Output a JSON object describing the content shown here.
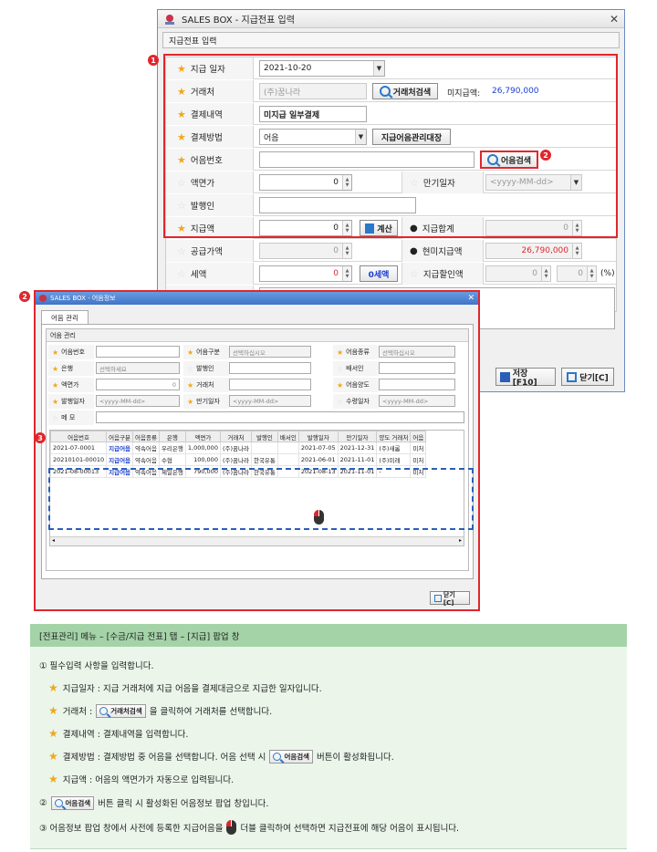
{
  "win1": {
    "title": "SALES BOX - 지급전표 입력",
    "tab": "지급전표 입력",
    "badge1": "1",
    "badge2": "2",
    "rows": {
      "date_label": "지급 일자",
      "date_value": "2021-10-20",
      "vendor_label": "거래처",
      "vendor_value": "(주)꿈나라",
      "vendor_btn": "거래처검색",
      "unpaid_label": "미지급액:",
      "unpaid_value": "26,790,000",
      "memo_label": "결제내역",
      "memo_value": "미지급 일부결제",
      "method_label": "결제방법",
      "method_value": "어음",
      "ledger_btn": "지급어음관리대장",
      "note_no_label": "어음번호",
      "note_search_btn": "어음검색",
      "face_label": "액면가",
      "face_value": "0",
      "due_label": "만기일자",
      "due_placeholder": "<yyyy-MM-dd>",
      "issuer_label": "발행인",
      "pay_label": "지급액",
      "pay_value": "0",
      "calc_btn": "계산",
      "total_label": "지급합계",
      "total_value": "0",
      "supply_label": "공급가액",
      "supply_value": "0",
      "cash_label": "현미지급액",
      "cash_value": "26,790,000",
      "tax_label": "세액",
      "tax_value": "0",
      "tax_btn": "0세액",
      "disc_label": "지급할인액",
      "disc_value": "0",
      "disc_value2": "0",
      "pct": "(%)"
    },
    "save_btn": "저장[F10]",
    "close_btn": "닫기[C]"
  },
  "win2": {
    "title": "SALES BOX - 어음정보",
    "badge": "2",
    "tab": "어음 관리",
    "panel_title": "어음 관리",
    "badge3": "3",
    "filters": {
      "note_no": "어음번호",
      "note_type": "어음구분",
      "note_type_ph": "선택하십시오",
      "note_kind": "어음종류",
      "note_kind_ph": "선택하십시오",
      "bank": "은행",
      "bank_ph": "선택하세요",
      "issuer": "발행인",
      "endorser": "배서인",
      "face": "액면가",
      "face_val": "0",
      "vendor": "거래처",
      "transferee": "어음양도",
      "issue_date": "발행일자",
      "date_ph": "<yyyy-MM-dd>",
      "due_date": "만기일자",
      "recv_date": "수령일자",
      "memo": "메 모"
    },
    "columns": [
      "어음번호",
      "어음구분",
      "어음종류",
      "은행",
      "액면가",
      "거래처",
      "발행인",
      "배서인",
      "발행일자",
      "만기일자",
      "양도 거래처",
      "어음"
    ],
    "rows": [
      [
        "2021-07-0001",
        "지급어음",
        "약속어음",
        "우리은행",
        "1,000,000",
        "(주)꿈나라",
        "",
        "",
        "2021-07-05",
        "2021-12-31",
        "(주)새롬",
        "미처"
      ],
      [
        "20210101-00010",
        "지급어음",
        "약속어음",
        "수협",
        "100,000",
        "(주)꿈나라",
        "한국유통",
        "",
        "2021-06-01",
        "2021-11-01",
        "(주)미래",
        "미처"
      ],
      [
        "2021-08-00013",
        "지급어음",
        "약속어음",
        "제일은행",
        "790,000",
        "(주)꿈나라",
        "한국유통",
        "",
        "2021-08-13",
        "2021-11-01",
        "-",
        "미처"
      ]
    ],
    "close_btn": "닫기[C]"
  },
  "notes": {
    "header": "[전표관리] 메뉴 – [수금/지급 전표] 탭 – [지급] 팝업 창",
    "l1": "① 필수입력 사항을 입력합니다.",
    "l2": "지급일자 : 지급 거래처에 지급 어음을 결제대금으로 지급한 일자입니다.",
    "l3a": "거래처 :",
    "l3b": "을 클릭하여 거래처를 선택합니다.",
    "l4": "결제내역 :  결제내역을 입력합니다.",
    "l5a": "결제방법 :  결제방법 중 어음을 선택합니다. 어음 선택 시",
    "l5b": "버튼이 활성화됩니다.",
    "l6": "지급액 : 어음의 액면가가 자동으로 입력됩니다.",
    "l7a": "②",
    "l7b": "버튼 클릭 시 활성화된 어음정보 팝업 창입니다.",
    "l8a": "③  어음정보 팝업 창에서 사전에 등록한 지급어음을",
    "l8b": "더블 클릭하여 선택하면 지급전표에 해당 어음이 표시됩니다.",
    "btn_vendor": "거래처검색",
    "btn_note": "어음검색"
  }
}
